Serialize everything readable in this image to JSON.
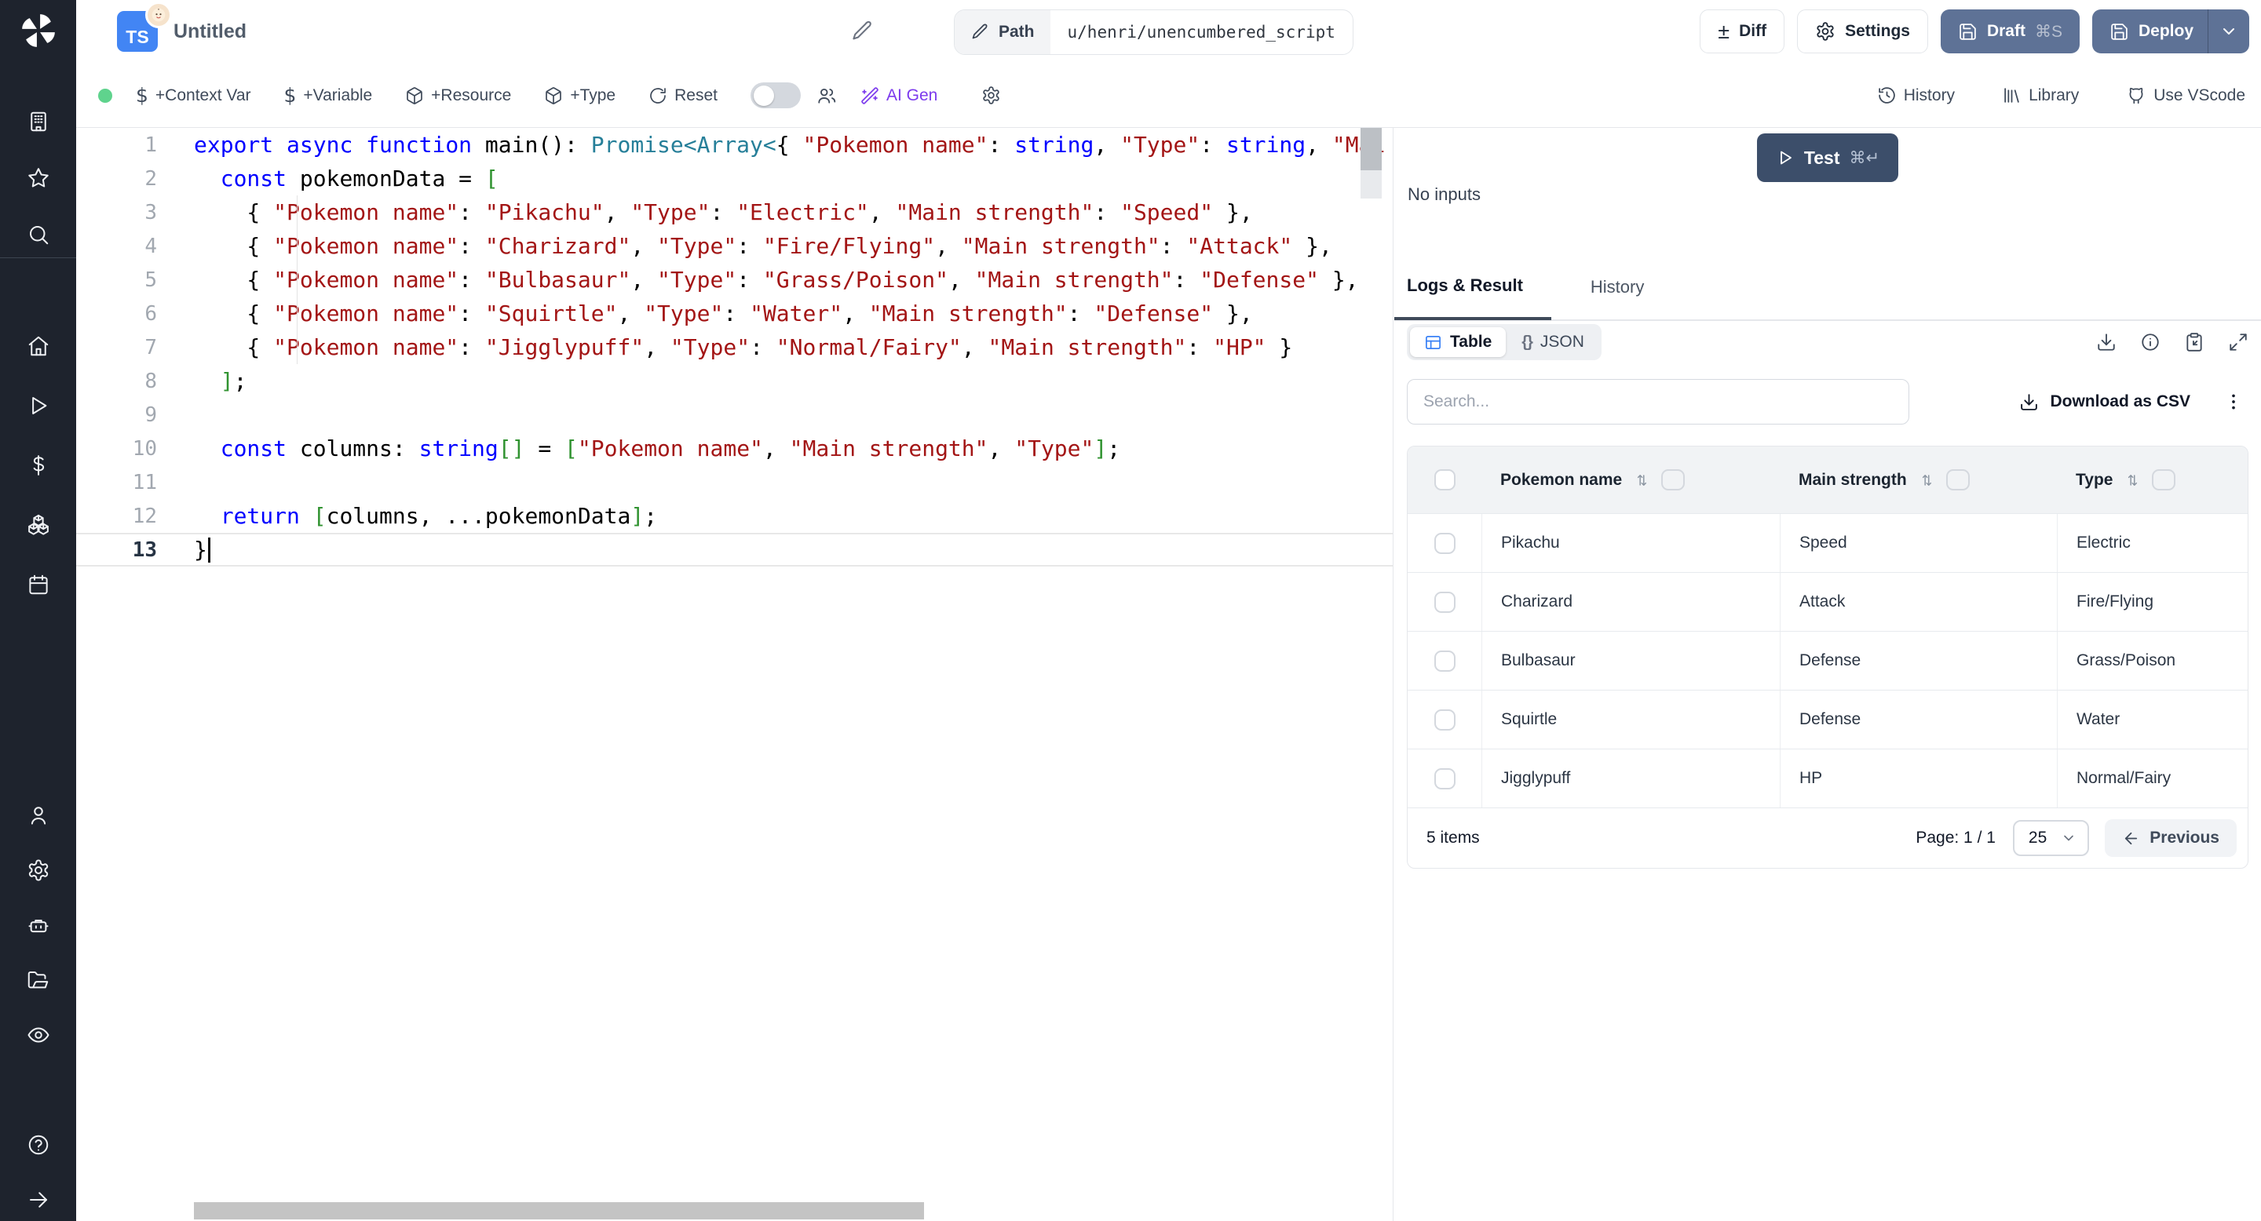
{
  "topbar": {
    "lang_badge": "TS",
    "title": "Untitled",
    "path_label": "Path",
    "path_value": "u/henri/unencumbered_script",
    "diff_label": "Diff",
    "settings_label": "Settings",
    "draft_label": "Draft",
    "draft_kbd": "⌘S",
    "deploy_label": "Deploy"
  },
  "toolbar": {
    "context_var": "+Context Var",
    "variable": "+Variable",
    "resource": "+Resource",
    "type": "+Type",
    "reset": "Reset",
    "ai_gen": "AI Gen",
    "history": "History",
    "library": "Library",
    "vscode": "Use VScode"
  },
  "sidebar": {
    "icons_top": [
      "building",
      "star",
      "search"
    ],
    "icons_main": [
      "home",
      "play",
      "dollar",
      "cubes",
      "calendar"
    ],
    "icons_lower": [
      "user",
      "gear",
      "robot",
      "folder",
      "eye"
    ],
    "icons_footer": [
      "help",
      "arrow-right"
    ]
  },
  "editor": {
    "lines": [
      {
        "n": "1",
        "t": [
          [
            "k",
            "export"
          ],
          [
            "d",
            " "
          ],
          [
            "k",
            "async"
          ],
          [
            "d",
            " "
          ],
          [
            "k",
            "function"
          ],
          [
            "d",
            " main(): "
          ],
          [
            "t",
            "Promise<Array<"
          ],
          [
            "d",
            "{ "
          ],
          [
            "s",
            "\"Pokemon name\""
          ],
          [
            "d",
            ": "
          ],
          [
            "k",
            "string"
          ],
          [
            "d",
            ", "
          ],
          [
            "s",
            "\"Type\""
          ],
          [
            "d",
            ": "
          ],
          [
            "k",
            "string"
          ],
          [
            "d",
            ", "
          ],
          [
            "s",
            "\"Mai"
          ]
        ]
      },
      {
        "n": "2",
        "t": [
          [
            "d",
            "  "
          ],
          [
            "k",
            "const"
          ],
          [
            "d",
            " pokemonData = "
          ],
          [
            "b",
            "["
          ]
        ]
      },
      {
        "n": "3",
        "t": [
          [
            "d",
            "    { "
          ],
          [
            "s",
            "\"Pokemon name\""
          ],
          [
            "d",
            ": "
          ],
          [
            "s",
            "\"Pikachu\""
          ],
          [
            "d",
            ", "
          ],
          [
            "s",
            "\"Type\""
          ],
          [
            "d",
            ": "
          ],
          [
            "s",
            "\"Electric\""
          ],
          [
            "d",
            ", "
          ],
          [
            "s",
            "\"Main strength\""
          ],
          [
            "d",
            ": "
          ],
          [
            "s",
            "\"Speed\""
          ],
          [
            "d",
            " },"
          ]
        ]
      },
      {
        "n": "4",
        "t": [
          [
            "d",
            "    { "
          ],
          [
            "s",
            "\"Pokemon name\""
          ],
          [
            "d",
            ": "
          ],
          [
            "s",
            "\"Charizard\""
          ],
          [
            "d",
            ", "
          ],
          [
            "s",
            "\"Type\""
          ],
          [
            "d",
            ": "
          ],
          [
            "s",
            "\"Fire/Flying\""
          ],
          [
            "d",
            ", "
          ],
          [
            "s",
            "\"Main strength\""
          ],
          [
            "d",
            ": "
          ],
          [
            "s",
            "\"Attack\""
          ],
          [
            "d",
            " },"
          ]
        ]
      },
      {
        "n": "5",
        "t": [
          [
            "d",
            "    { "
          ],
          [
            "s",
            "\"Pokemon name\""
          ],
          [
            "d",
            ": "
          ],
          [
            "s",
            "\"Bulbasaur\""
          ],
          [
            "d",
            ", "
          ],
          [
            "s",
            "\"Type\""
          ],
          [
            "d",
            ": "
          ],
          [
            "s",
            "\"Grass/Poison\""
          ],
          [
            "d",
            ", "
          ],
          [
            "s",
            "\"Main strength\""
          ],
          [
            "d",
            ": "
          ],
          [
            "s",
            "\"Defense\""
          ],
          [
            "d",
            " },"
          ]
        ]
      },
      {
        "n": "6",
        "t": [
          [
            "d",
            "    { "
          ],
          [
            "s",
            "\"Pokemon name\""
          ],
          [
            "d",
            ": "
          ],
          [
            "s",
            "\"Squirtle\""
          ],
          [
            "d",
            ", "
          ],
          [
            "s",
            "\"Type\""
          ],
          [
            "d",
            ": "
          ],
          [
            "s",
            "\"Water\""
          ],
          [
            "d",
            ", "
          ],
          [
            "s",
            "\"Main strength\""
          ],
          [
            "d",
            ": "
          ],
          [
            "s",
            "\"Defense\""
          ],
          [
            "d",
            " },"
          ]
        ]
      },
      {
        "n": "7",
        "t": [
          [
            "d",
            "    { "
          ],
          [
            "s",
            "\"Pokemon name\""
          ],
          [
            "d",
            ": "
          ],
          [
            "s",
            "\"Jigglypuff\""
          ],
          [
            "d",
            ", "
          ],
          [
            "s",
            "\"Type\""
          ],
          [
            "d",
            ": "
          ],
          [
            "s",
            "\"Normal/Fairy\""
          ],
          [
            "d",
            ", "
          ],
          [
            "s",
            "\"Main strength\""
          ],
          [
            "d",
            ": "
          ],
          [
            "s",
            "\"HP\""
          ],
          [
            "d",
            " }"
          ]
        ]
      },
      {
        "n": "8",
        "t": [
          [
            "d",
            "  "
          ],
          [
            "b",
            "]"
          ],
          [
            "d",
            ";"
          ]
        ]
      },
      {
        "n": "9",
        "t": []
      },
      {
        "n": "10",
        "t": [
          [
            "d",
            "  "
          ],
          [
            "k",
            "const"
          ],
          [
            "d",
            " columns: "
          ],
          [
            "k",
            "string"
          ],
          [
            "b",
            "[]"
          ],
          [
            "d",
            " = "
          ],
          [
            "b",
            "["
          ],
          [
            "s",
            "\"Pokemon name\""
          ],
          [
            "d",
            ", "
          ],
          [
            "s",
            "\"Main strength\""
          ],
          [
            "d",
            ", "
          ],
          [
            "s",
            "\"Type\""
          ],
          [
            "b",
            "]"
          ],
          [
            "d",
            ";"
          ]
        ]
      },
      {
        "n": "11",
        "t": []
      },
      {
        "n": "12",
        "t": [
          [
            "d",
            "  "
          ],
          [
            "k",
            "return"
          ],
          [
            "d",
            " "
          ],
          [
            "b",
            "["
          ],
          [
            "d",
            "columns, ...pokemonData"
          ],
          [
            "b",
            "]"
          ],
          [
            "d",
            ";"
          ]
        ]
      },
      {
        "n": "13",
        "t": [
          [
            "d",
            "}"
          ]
        ],
        "active": true
      }
    ]
  },
  "panel": {
    "test_label": "Test",
    "test_kbd": "⌘↵",
    "no_inputs": "No inputs",
    "tab_logs": "Logs & Result",
    "tab_history": "History",
    "view_table": "Table",
    "view_json": "JSON",
    "json_braces": "{}",
    "search_placeholder": "Search...",
    "download_csv": "Download as CSV"
  },
  "table": {
    "headers": [
      "Pokemon name",
      "Main strength",
      "Type"
    ],
    "rows": [
      [
        "Pikachu",
        "Speed",
        "Electric"
      ],
      [
        "Charizard",
        "Attack",
        "Fire/Flying"
      ],
      [
        "Bulbasaur",
        "Defense",
        "Grass/Poison"
      ],
      [
        "Squirtle",
        "Defense",
        "Water"
      ],
      [
        "Jigglypuff",
        "HP",
        "Normal/Fairy"
      ]
    ],
    "items_label": "5 items",
    "page_label": "Page: 1 / 1",
    "page_size": "25",
    "previous_label": "Previous"
  },
  "colors": {
    "sidebar_bg": "#1e232d",
    "primary_button": "#5e7296",
    "test_button": "#3c4e6a",
    "ts_badge": "#4285f4",
    "ai_accent": "#7c3aed",
    "green_status_dot": "#5fd38d",
    "table_view_icon": "#3b82f6",
    "code_keyword": "#0000ff",
    "code_type": "#267f99",
    "code_string": "#a31515",
    "code_bracket": "#319331"
  }
}
